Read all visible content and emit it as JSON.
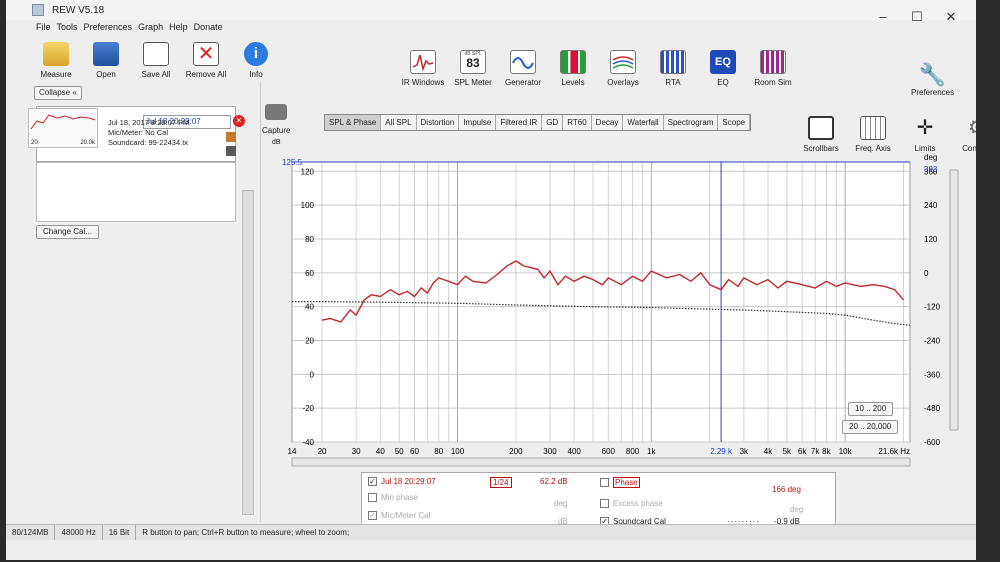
{
  "window": {
    "title": "REW V5.18"
  },
  "menu": [
    "File",
    "Tools",
    "Preferences",
    "Graph",
    "Help",
    "Donate"
  ],
  "toolbar_left": [
    {
      "label": "Measure",
      "icon": "measure-icon"
    },
    {
      "label": "Open",
      "icon": "open-icon"
    },
    {
      "label": "Save All",
      "icon": "save-all-icon"
    },
    {
      "label": "Remove All",
      "icon": "remove-all-icon"
    },
    {
      "label": "Info",
      "icon": "info-icon"
    }
  ],
  "toolbar_mid": [
    {
      "label": "IR Windows",
      "icon": "ir-windows-icon"
    },
    {
      "label": "SPL Meter",
      "icon": "spl-meter-icon",
      "readout_top": "dB SPL",
      "readout": "83"
    },
    {
      "label": "Generator",
      "icon": "generator-icon"
    },
    {
      "label": "Levels",
      "icon": "levels-icon"
    },
    {
      "label": "Overlays",
      "icon": "overlays-icon"
    },
    {
      "label": "RTA",
      "icon": "rta-icon"
    },
    {
      "label": "EQ",
      "icon": "eq-icon"
    },
    {
      "label": "Room Sim",
      "icon": "room-sim-icon"
    }
  ],
  "preferences_label": "Preferences",
  "side": {
    "collapse_label": "Collapse",
    "meas_name": "Jul 18 20:29:07",
    "meas_date": "Jul 18, 2017 8:29:07 PM",
    "mic": "Mic/Meter: No Cal",
    "soundcard": "Soundcard: 99-22434.tx",
    "thumb_left": "20",
    "thumb_right": "20.0k",
    "change_cal_label": "Change Cal..."
  },
  "capture": {
    "label": "Capture",
    "unit": "dB"
  },
  "tabs": [
    "SPL & Phase",
    "All SPL",
    "Distortion",
    "Impulse",
    "Filtered IR",
    "GD",
    "RT60",
    "Decay",
    "Waterfall",
    "Spectrogram",
    "Scope"
  ],
  "active_tab": "SPL & Phase",
  "tools_right": [
    {
      "label": "Scrollbars",
      "icon": "scrollbars-icon"
    },
    {
      "label": "Freq. Axis",
      "icon": "freq-axis-icon"
    },
    {
      "label": "Limits",
      "icon": "limits-icon"
    },
    {
      "label": "Controls",
      "icon": "controls-icon"
    }
  ],
  "chart_data": {
    "type": "line",
    "xscale": "log",
    "xlim": [
      14,
      21600
    ],
    "ylim": [
      -40,
      125.5
    ],
    "y2lim": [
      -600,
      393
    ],
    "ylabel": "dB",
    "y2label": "deg",
    "xticks": [
      "14",
      "20",
      "30",
      "40",
      "50",
      "60",
      "80",
      "100",
      "200",
      "300",
      "400",
      "600",
      "800",
      "1k",
      "2.29 k",
      "3k",
      "4k",
      "5k",
      "6k",
      "7k",
      "8k",
      "10k",
      "21.6k Hz"
    ],
    "xtick_values": [
      14,
      20,
      30,
      40,
      50,
      60,
      80,
      100,
      200,
      300,
      400,
      600,
      800,
      1000,
      2290,
      3000,
      4000,
      5000,
      6000,
      7000,
      8000,
      10000,
      21600
    ],
    "yticks": [
      120,
      100,
      80,
      60,
      40,
      20,
      0,
      -20,
      -40
    ],
    "y2ticks": [
      360,
      240,
      120,
      0,
      -120,
      -240,
      -360,
      -480,
      -600
    ],
    "y_top_marker": "125.5",
    "y2_top_marker": "393",
    "cursor_x": 2290,
    "cursor_label": "2.29 k",
    "grid": true,
    "series": [
      {
        "name": "Jul 18 20:29:07",
        "color": "#c0282a",
        "x": [
          20,
          22,
          25,
          28,
          30,
          33,
          36,
          40,
          45,
          50,
          55,
          60,
          65,
          70,
          75,
          80,
          90,
          100,
          110,
          120,
          140,
          160,
          180,
          200,
          220,
          240,
          260,
          280,
          300,
          330,
          360,
          400,
          450,
          500,
          560,
          600,
          700,
          800,
          900,
          1000,
          1200,
          1400,
          1600,
          1800,
          2000,
          2290,
          2500,
          2800,
          3000,
          3500,
          4000,
          4500,
          5000,
          6000,
          7000,
          8000,
          9000,
          10000,
          12000,
          14000,
          16000,
          18000,
          20000
        ],
        "y": [
          32,
          33,
          31,
          38,
          35,
          44,
          47,
          46,
          50,
          47,
          49,
          46,
          51,
          48,
          54,
          57,
          55,
          53,
          58,
          55,
          54,
          59,
          64,
          67,
          64,
          63,
          62,
          57,
          61,
          53,
          58,
          55,
          58,
          56,
          53,
          57,
          53,
          58,
          55,
          61,
          57,
          59,
          55,
          60,
          53,
          50,
          56,
          52,
          57,
          53,
          56,
          51,
          55,
          53,
          51,
          55,
          52,
          54,
          52,
          53,
          52,
          50,
          44
        ]
      },
      {
        "name": "Soundcard Cal",
        "color": "#333333",
        "style": "dotted",
        "x": [
          14,
          20,
          50,
          100,
          200,
          500,
          1000,
          2000,
          3000,
          5000,
          8000,
          10000,
          14000,
          18000,
          21600
        ],
        "y": [
          43,
          43,
          42.5,
          42,
          41,
          40,
          39.5,
          38.5,
          38,
          37,
          36,
          35,
          32,
          30,
          29
        ]
      }
    ],
    "range_buttons": [
      "10 .. 200",
      "20 .. 20,000"
    ]
  },
  "legend": {
    "meas_label": "Jul 18 20:29:07",
    "smoothing": "1/24",
    "spl_value": "62.2 dB",
    "phase_label": "Phase",
    "phase_value": "166 deg",
    "min_phase_label": "Min phase",
    "min_phase_unit": "deg",
    "excess_phase_label": "Excess phase",
    "excess_phase_unit": "deg",
    "mic_cal_label": "Mic/Meter Cal",
    "mic_cal_unit": "dB",
    "soundcard_cal_label": "Soundcard Cal",
    "soundcard_cal_value": "-0.9 dB"
  },
  "status": {
    "memory": "80/124MB",
    "rate": "48000 Hz",
    "bits": "16 Bit",
    "hint": "R button to pan; Ctrl+R button to measure; wheel to zoom;"
  }
}
